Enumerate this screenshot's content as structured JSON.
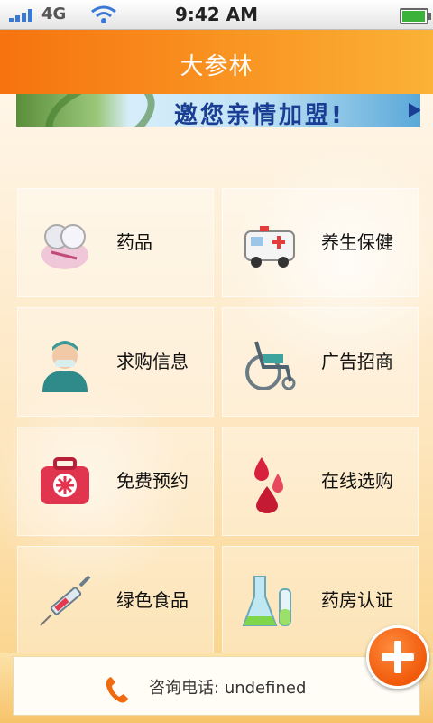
{
  "status_bar": {
    "network": "4G",
    "time": "9:42 AM",
    "battery_level": 0.9,
    "icons": [
      "signal-icon",
      "wifi-icon",
      "battery-icon"
    ]
  },
  "header": {
    "title": "大参林"
  },
  "banner": {
    "text": "邀您亲情加盟!"
  },
  "menu": {
    "items": [
      {
        "label": "药品",
        "icon": "medicine-icon"
      },
      {
        "label": "养生保健",
        "icon": "ambulance-icon"
      },
      {
        "label": "求购信息",
        "icon": "doctor-icon"
      },
      {
        "label": "广告招商",
        "icon": "wheelchair-icon"
      },
      {
        "label": "免费预约",
        "icon": "first-aid-kit-icon"
      },
      {
        "label": "在线选购",
        "icon": "blood-drop-icon"
      },
      {
        "label": "绿色食品",
        "icon": "syringe-icon"
      },
      {
        "label": "药房认证",
        "icon": "flask-icon"
      }
    ]
  },
  "footer": {
    "phone_prefix": "咨询电话:",
    "phone_value": "undefined"
  },
  "colors": {
    "header_orange": "#f6730f",
    "accent_orange": "#f05a0a",
    "banner_blue": "#1a3e94"
  }
}
